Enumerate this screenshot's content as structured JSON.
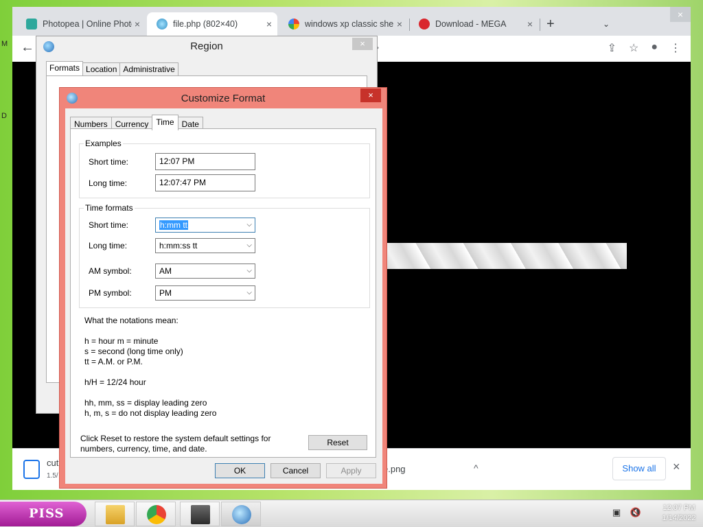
{
  "desktop": {
    "frag1": "M",
    "frag2": "D"
  },
  "browser": {
    "tabs": [
      {
        "label": "Photopea | Online Photo",
        "color": "#2ea89c",
        "active": false
      },
      {
        "label": "file.php (802×40)",
        "color": "#3fa9d6",
        "active": true
      },
      {
        "label": "windows xp classic shell",
        "color": "#4285f4",
        "active": false
      },
      {
        "label": "Download - MEGA",
        "color": "#d9272e",
        "active": false
      }
    ],
    "tab_close": "×",
    "new_tab": "+",
    "tab_dropdown": "⌄",
    "window_close": "×",
    "back": "←",
    "toolbar_icons": [
      "⇪",
      "☆",
      "●",
      "⋮"
    ],
    "downloads": {
      "item1_name": "cut",
      "item1_sub": "1.5/",
      "item2_name": "e.png",
      "expand": "^",
      "show_all": "Show all",
      "close": "×"
    }
  },
  "region": {
    "title": "Region",
    "close": "×",
    "tabs": [
      "Formats",
      "Location",
      "Administrative"
    ]
  },
  "customize": {
    "title": "Customize Format",
    "close": "×",
    "tabs": [
      "Numbers",
      "Currency",
      "Time",
      "Date"
    ],
    "examples": {
      "legend": "Examples",
      "short_label": "Short time:",
      "short_value": "12:07 PM",
      "long_label": "Long time:",
      "long_value": "12:07:47 PM"
    },
    "formats": {
      "legend": "Time formats",
      "short_label": "Short time:",
      "short_value": "h:mm tt",
      "long_label": "Long time:",
      "long_value": "h:mm:ss tt",
      "am_label": "AM symbol:",
      "am_value": "AM",
      "pm_label": "PM symbol:",
      "pm_value": "PM"
    },
    "notes": {
      "heading": "What the notations mean:",
      "line1": "h = hour   m = minute",
      "line2": "s = second (long time only)",
      "line3": "tt = A.M. or P.M.",
      "line4": "h/H = 12/24 hour",
      "line5": "hh, mm, ss = display leading zero",
      "line6": "h, m, s = do not display leading zero"
    },
    "reset_text": "Click Reset to restore the system default settings for numbers, currency, time, and date.",
    "reset": "Reset",
    "ok": "OK",
    "cancel": "Cancel",
    "apply": "Apply"
  },
  "taskbar": {
    "start_label": "PISS",
    "clock_time": "12:07 PM",
    "clock_date": "1/14/2022",
    "tray_icons": [
      "network-icon",
      "volume-muted-icon"
    ]
  }
}
